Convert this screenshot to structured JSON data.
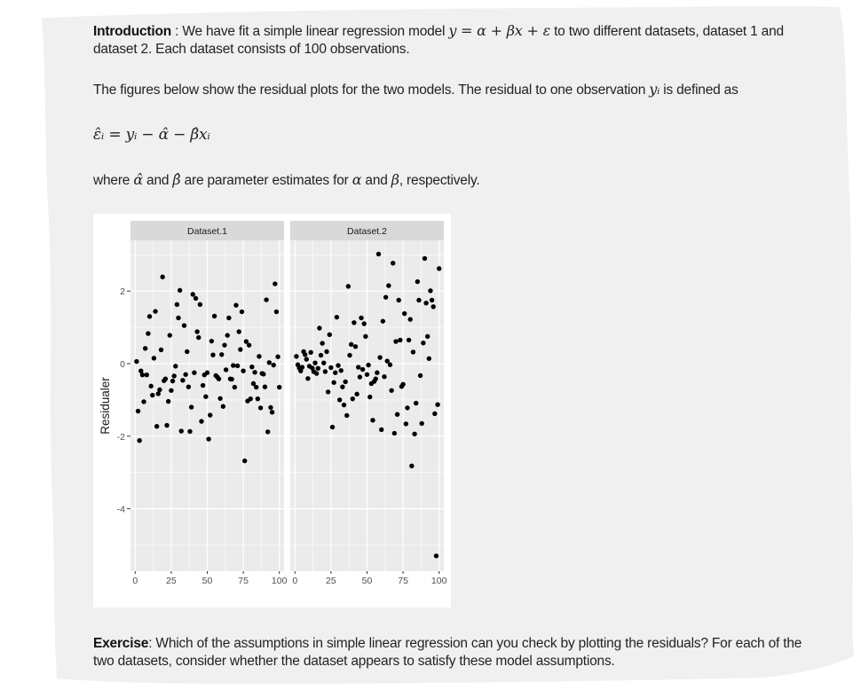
{
  "intro": {
    "label": "Introduction",
    "sep": " : ",
    "text_a": " We have fit a simple linear regression model ",
    "model_eq": "y = α + βx + ε",
    "text_b": " to two different datasets, dataset 1 and dataset 2. Each dataset consists of 100 observations."
  },
  "figures_text": {
    "text_a": "The figures below show the residual plots for the two models. The residual to one observation ",
    "var": "yᵢ",
    "text_b": " is defined as"
  },
  "residual_eq": "ε̂ᵢ = yᵢ − α̂ − β̂xᵢ",
  "where_text": {
    "a": "where ",
    "alpha_hat": "α̂",
    "b": " and ",
    "beta_hat": "β̂",
    "c": " are parameter estimates for ",
    "alpha": "α",
    "d": " and ",
    "beta": "β",
    "e": ", respectively."
  },
  "exercise": {
    "label": "Exercise",
    "text": ": Which of the assumptions in simple linear regression can you check by plotting the residuals? For each of the two datasets, consider whether the dataset appears to satisfy these model assumptions."
  },
  "colors": {
    "page_bg": "#f0f0f0",
    "panel_bg": "#ebebeb",
    "strip_bg": "#d9d9d9",
    "grid": "#ffffff",
    "point": "#000000",
    "tick_text": "#4d4d4d"
  },
  "chart_data": {
    "type": "scatter",
    "title": "",
    "xlabel": "",
    "ylabel": "Residualer",
    "xlim": [
      0,
      100
    ],
    "ylim": [
      -5.5,
      3.3
    ],
    "x_ticks": [
      0,
      25,
      50,
      75,
      100
    ],
    "x_tick_labels": [
      "0",
      "25",
      "50",
      "75",
      "100"
    ],
    "y_ticks": [
      2,
      0,
      -2,
      -4
    ],
    "y_tick_labels": [
      "2",
      "0",
      "-2",
      "-4"
    ],
    "grid": true,
    "legend": "none",
    "facets": [
      {
        "name": "Dataset.1",
        "x": [
          1,
          2,
          3,
          4,
          5,
          6,
          7,
          8,
          9,
          10,
          11,
          12,
          13,
          14,
          15,
          16,
          17,
          18,
          19,
          20,
          21,
          22,
          23,
          24,
          25,
          26,
          27,
          28,
          29,
          30,
          31,
          32,
          33,
          34,
          35,
          36,
          37,
          38,
          39,
          40,
          41,
          42,
          43,
          44,
          45,
          46,
          47,
          48,
          49,
          50,
          51,
          52,
          53,
          54,
          55,
          56,
          57,
          58,
          59,
          60,
          61,
          62,
          63,
          64,
          65,
          66,
          67,
          68,
          69,
          70,
          71,
          72,
          73,
          74,
          75,
          76,
          77,
          78,
          79,
          80,
          81,
          82,
          83,
          84,
          85,
          86,
          87,
          88,
          89,
          90,
          91,
          92,
          93,
          94,
          95,
          96,
          97,
          98,
          99,
          100
        ],
        "y": [
          0.06,
          -1.31,
          -2.12,
          -0.2,
          -0.31,
          -1.05,
          0.42,
          -0.31,
          0.83,
          1.3,
          -0.62,
          -0.87,
          0.15,
          1.44,
          -1.73,
          -0.83,
          -0.72,
          0.38,
          2.39,
          -0.47,
          -0.42,
          -1.7,
          -1.04,
          0.78,
          -0.74,
          -0.48,
          -0.34,
          -0.07,
          1.63,
          1.26,
          2.02,
          -1.86,
          -0.46,
          1.05,
          -0.3,
          0.33,
          -0.64,
          -1.87,
          -1.2,
          1.91,
          -0.25,
          1.8,
          0.88,
          0.72,
          1.63,
          -1.59,
          -0.6,
          -0.31,
          -0.91,
          -0.25,
          -2.08,
          -1.42,
          0.62,
          0.24,
          1.31,
          -0.33,
          -0.37,
          -0.42,
          -0.96,
          0.25,
          -1.18,
          0.51,
          -0.17,
          0.78,
          1.26,
          -0.42,
          -0.43,
          -0.05,
          -0.65,
          1.61,
          -0.06,
          0.88,
          0.39,
          1.43,
          -0.2,
          -2.68,
          0.61,
          -1.03,
          0.51,
          -0.97,
          -0.09,
          -0.55,
          -0.24,
          -0.65,
          -0.97,
          0.2,
          -1.22,
          -0.27,
          -0.29,
          -0.64,
          1.76,
          -1.88,
          0.03,
          -1.21,
          -1.34,
          -0.04,
          2.2,
          1.43,
          0.19,
          -0.65
        ]
      },
      {
        "name": "Dataset.2",
        "x": [
          1,
          2,
          3,
          4,
          5,
          6,
          7,
          8,
          9,
          10,
          11,
          12,
          13,
          14,
          15,
          16,
          17,
          18,
          19,
          20,
          21,
          22,
          23,
          24,
          25,
          26,
          27,
          28,
          29,
          30,
          31,
          32,
          33,
          34,
          35,
          36,
          37,
          38,
          39,
          40,
          41,
          42,
          43,
          44,
          45,
          46,
          47,
          48,
          49,
          50,
          51,
          52,
          53,
          54,
          55,
          56,
          57,
          58,
          59,
          60,
          61,
          62,
          63,
          64,
          65,
          66,
          67,
          68,
          69,
          70,
          71,
          72,
          73,
          74,
          75,
          76,
          77,
          78,
          79,
          80,
          81,
          82,
          83,
          84,
          85,
          86,
          87,
          88,
          89,
          90,
          91,
          92,
          93,
          94,
          95,
          96,
          97,
          98,
          99,
          100
        ],
        "y": [
          0.2,
          -0.03,
          -0.12,
          -0.2,
          -0.1,
          0.33,
          0.25,
          0.12,
          -0.41,
          -0.07,
          0.31,
          -0.12,
          -0.22,
          0.02,
          -0.27,
          -0.13,
          0.98,
          0.23,
          0.56,
          0.02,
          -0.22,
          0.33,
          -0.78,
          0.8,
          -0.11,
          -1.75,
          -0.52,
          -0.25,
          1.28,
          -0.05,
          -1.0,
          -0.19,
          -0.64,
          -1.14,
          -0.5,
          -1.43,
          2.13,
          0.23,
          0.53,
          -0.97,
          1.13,
          0.47,
          -0.84,
          -0.1,
          -0.37,
          1.26,
          -0.16,
          1.1,
          0.75,
          -0.3,
          -0.04,
          -0.92,
          -0.55,
          -1.56,
          -0.49,
          -0.42,
          -0.25,
          3.02,
          0.17,
          -1.82,
          1.17,
          -0.36,
          1.83,
          0.07,
          2.15,
          -0.03,
          -0.74,
          2.77,
          -1.92,
          0.61,
          -1.4,
          1.75,
          0.65,
          -0.63,
          -0.57,
          1.38,
          -1.66,
          -1.22,
          0.65,
          1.22,
          -2.82,
          0.32,
          -1.94,
          -1.09,
          2.26,
          1.75,
          -0.33,
          -1.65,
          0.57,
          2.9,
          1.67,
          0.75,
          0.14,
          2.01,
          1.75,
          1.57,
          -1.38,
          -5.3,
          -1.13,
          2.62
        ]
      }
    ]
  }
}
